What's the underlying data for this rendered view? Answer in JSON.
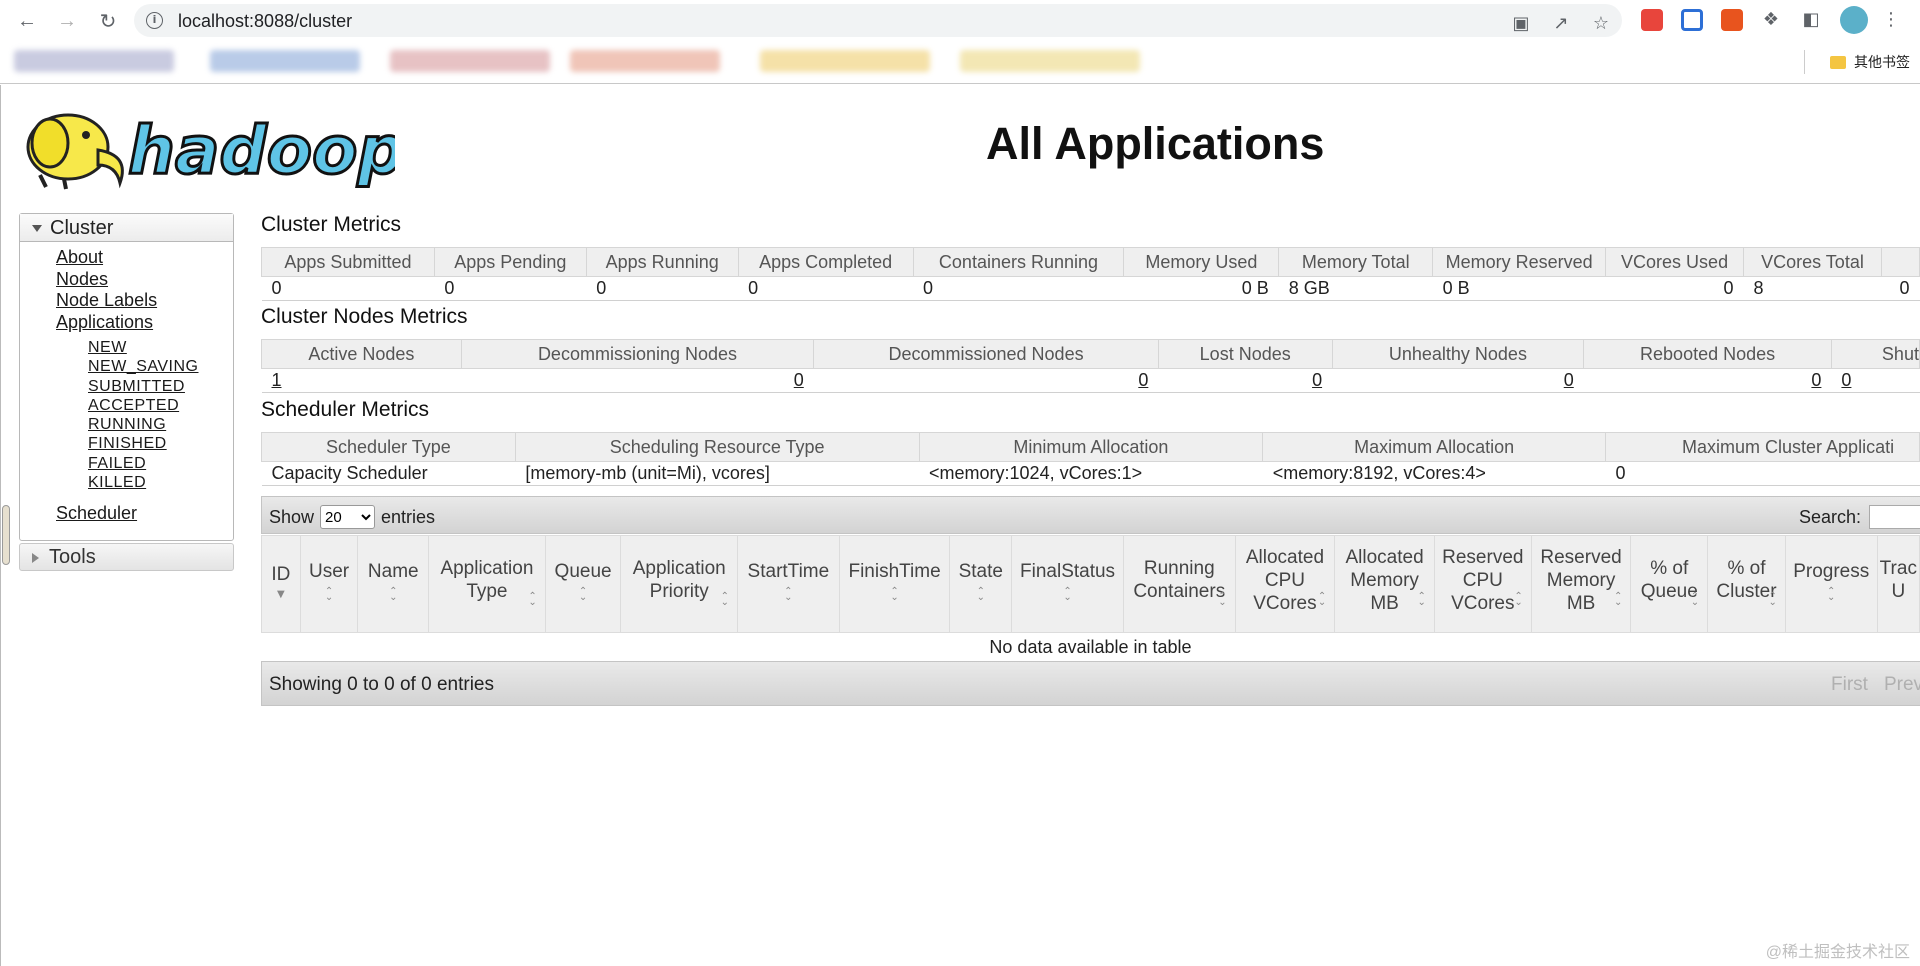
{
  "browser": {
    "url": "localhost:8088/cluster",
    "bookmarks_other": "其他书签"
  },
  "header": {
    "logo_text": "hadoop",
    "title": "All Applications"
  },
  "sidebar": {
    "cluster_label": "Cluster",
    "links": [
      "About",
      "Nodes",
      "Node Labels",
      "Applications"
    ],
    "app_states": [
      "NEW",
      "NEW_SAVING",
      "SUBMITTED",
      "ACCEPTED",
      "RUNNING",
      "FINISHED",
      "FAILED",
      "KILLED"
    ],
    "scheduler_label": "Scheduler",
    "tools_label": "Tools"
  },
  "cluster_metrics": {
    "title": "Cluster Metrics",
    "headers": [
      "Apps Submitted",
      "Apps Pending",
      "Apps Running",
      "Apps Completed",
      "Containers Running",
      "Memory Used",
      "Memory Total",
      "Memory Reserved",
      "VCores Used",
      "VCores Total"
    ],
    "values": [
      "0",
      "0",
      "0",
      "0",
      "0",
      "0 B",
      "8 GB",
      "0 B",
      "0",
      "8"
    ],
    "trailing_value": "0"
  },
  "node_metrics": {
    "title": "Cluster Nodes Metrics",
    "headers": [
      "Active Nodes",
      "Decommissioning Nodes",
      "Decommissioned Nodes",
      "Lost Nodes",
      "Unhealthy Nodes",
      "Rebooted Nodes",
      "Shut"
    ],
    "values": [
      "1",
      "0",
      "0",
      "0",
      "0",
      "0",
      "0"
    ]
  },
  "scheduler_metrics": {
    "title": "Scheduler Metrics",
    "headers": [
      "Scheduler Type",
      "Scheduling Resource Type",
      "Minimum Allocation",
      "Maximum Allocation",
      "Maximum Cluster Applicati"
    ],
    "values": [
      "Capacity Scheduler",
      "[memory-mb (unit=Mi), vcores]",
      "<memory:1024, vCores:1>",
      "<memory:8192, vCores:4>",
      "0"
    ]
  },
  "apps_table": {
    "show_label": "Show",
    "page_size": "20",
    "entries_label": "entries",
    "search_label": "Search:",
    "columns": [
      "ID",
      "User",
      "Name",
      "Application Type",
      "Queue",
      "Application Priority",
      "StartTime",
      "FinishTime",
      "State",
      "FinalStatus",
      "Running Containers",
      "Allocated CPU VCores",
      "Allocated Memory MB",
      "Reserved CPU VCores",
      "Reserved Memory MB",
      "% of Queue",
      "% of Cluster",
      "Progress",
      "Trac U"
    ],
    "empty_message": "No data available in table",
    "info": "Showing 0 to 0 of 0 entries",
    "pager_first": "First",
    "pager_prev": "Prev"
  },
  "watermark": "@稀土掘金技术社区"
}
